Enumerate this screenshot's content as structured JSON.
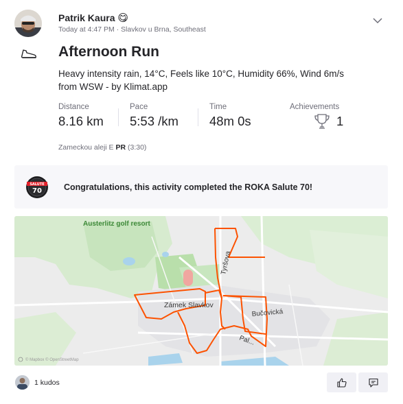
{
  "athlete": {
    "name": "Patrik Kaura",
    "emoji": "😋",
    "meta": "Today at 4:47 PM · Slavkov u Brna, Southeast"
  },
  "activity": {
    "sport_icon": "running-shoe-icon",
    "title": "Afternoon Run",
    "description": "Heavy intensity rain, 14°C, Feels like 10°C, Humidity 66%, Wind 6m/s from WSW - by Klimat.app"
  },
  "stats": {
    "distance": {
      "label": "Distance",
      "value": "8.16 km"
    },
    "pace": {
      "label": "Pace",
      "value": "5:53 /km"
    },
    "time": {
      "label": "Time",
      "value": "48m 0s"
    },
    "achievements": {
      "label": "Achievements",
      "value": "1"
    }
  },
  "segment": {
    "name": "Zameckou aleji E",
    "pr_label": "PR",
    "pr_time": "(3:30)"
  },
  "challenge": {
    "badge_line1": "SALUTE",
    "badge_line2": "70",
    "text": "Congratulations, this activity completed the ROKA Salute 70!"
  },
  "map": {
    "labels": {
      "golf": "Austerlitz golf resort",
      "chateau": "Zámek Slavkov",
      "street_tyrsova": "Tyršova",
      "street_bucovicka": "Bučovická",
      "street_palacky": "Pal..."
    },
    "attribution": "© Mapbox © OpenStreetMap",
    "route_color": "#fc5200"
  },
  "social": {
    "kudos": "1 kudos",
    "kudos_icon": "thumbs-up-icon",
    "comment_icon": "comment-icon"
  },
  "colors": {
    "brand": "#fc5200",
    "text": "#242428",
    "muted": "#6d6d78"
  }
}
